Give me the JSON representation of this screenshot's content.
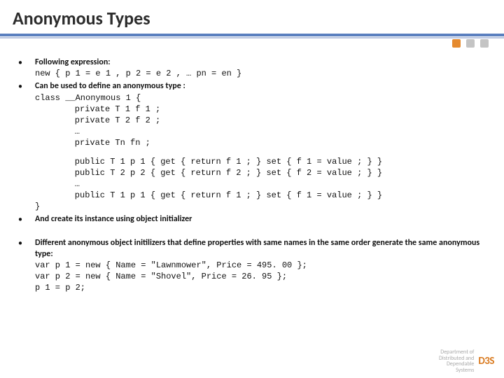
{
  "title": "Anonymous Types",
  "bullets": {
    "b1": {
      "text": "Following expression:",
      "code": "new { p 1 = e 1 , p 2 = e 2 , … pn = en }"
    },
    "b2": {
      "text": "Can be used to define an anonymous type :",
      "code_lines": [
        "class __Anonymous 1 {",
        "    private T 1 f 1 ;",
        "    private T 2 f 2 ;",
        "    …",
        "    private Tn fn ;",
        "",
        "    public T 1 p 1 { get { return f 1 ; } set { f 1 = value ; } }",
        "    public T 2 p 2 { get { return f 2 ; } set { f 2 = value ; } }",
        "    …",
        "    public T 1 p 1 { get { return f 1 ; } set { f 1 = value ; } }",
        "}"
      ]
    },
    "b3": {
      "text": "And create its instance using object initializer"
    },
    "b4": {
      "text": "Different anonymous object initilizers that define properties with same names in the same order generate the same anonymous type:",
      "code_lines": [
        "var p 1 = new { Name = \"Lawnmower\", Price = 495. 00 };",
        "var p 2 = new { Name = \"Shovel\", Price = 26. 95 };",
        "p 1 = p 2;"
      ]
    }
  },
  "footer": {
    "line1": "Department of",
    "line2": "Distributed and",
    "line3": "Dependable",
    "line4": "Systems",
    "logo": "D3S"
  }
}
